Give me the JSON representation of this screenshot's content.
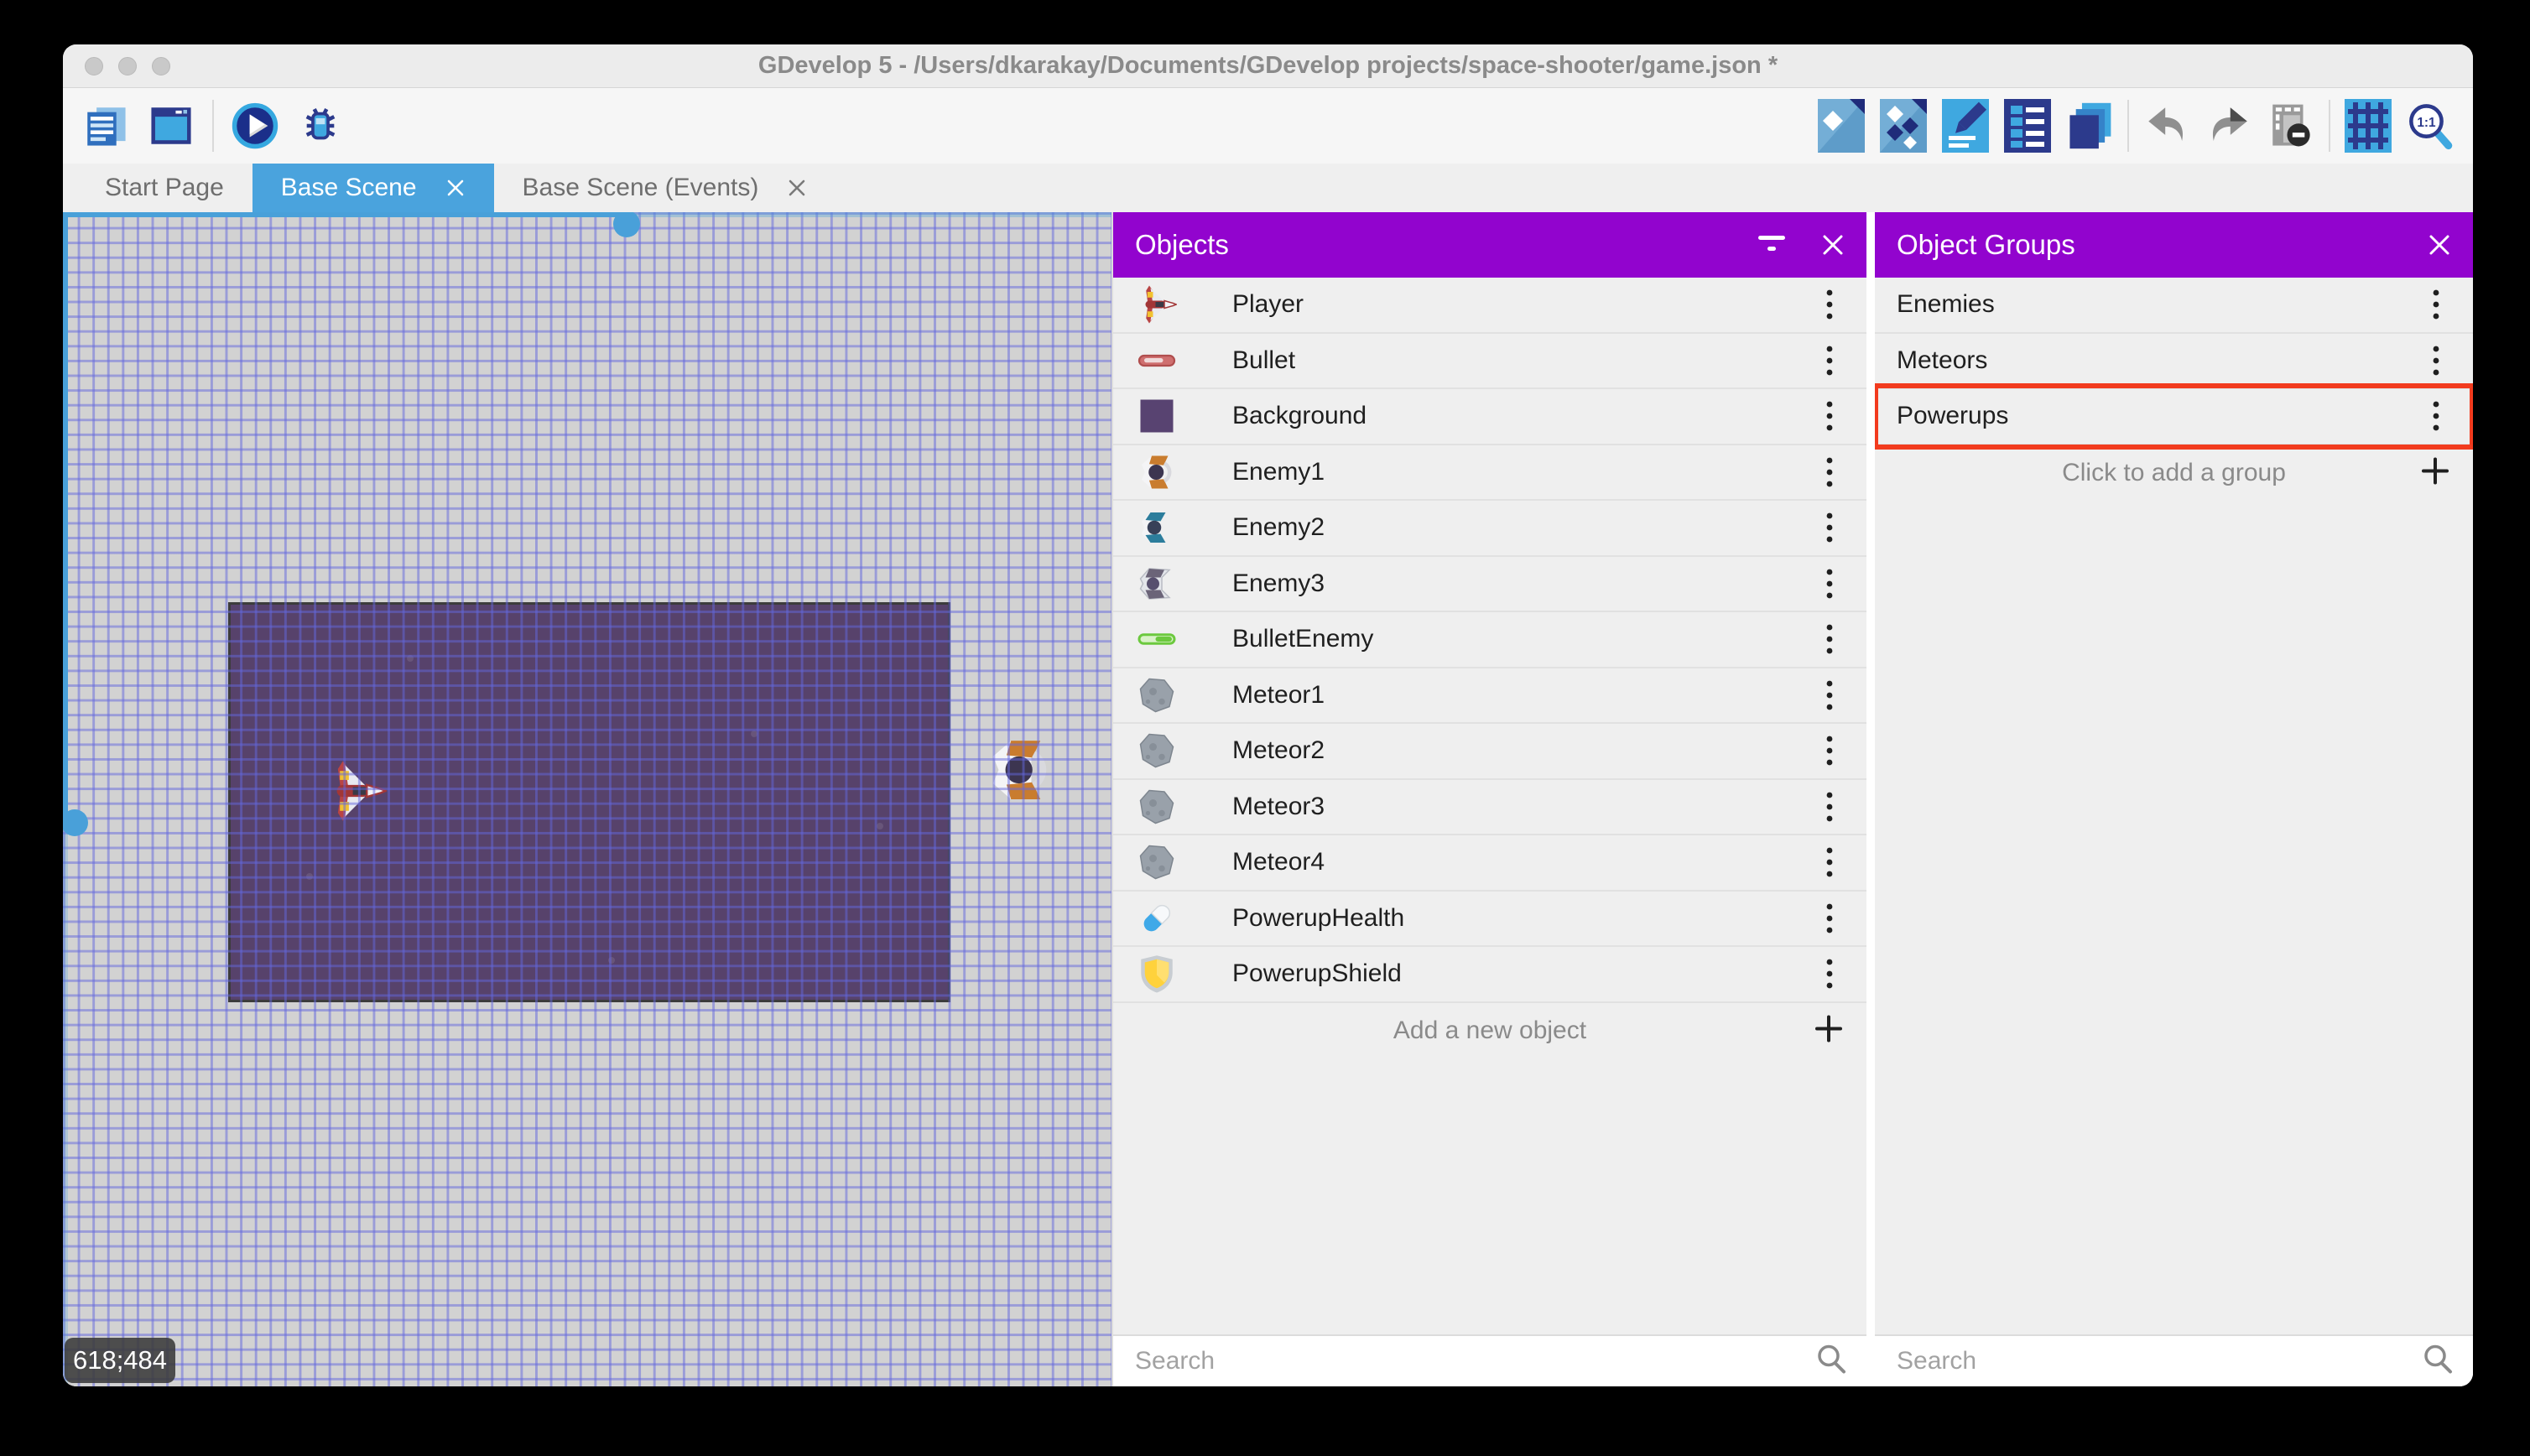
{
  "window": {
    "title": "GDevelop 5 - /Users/dkarakay/Documents/GDevelop projects/space-shooter/game.json *",
    "traffic_lights": [
      "close",
      "minimize",
      "maximize"
    ]
  },
  "toolbar": {
    "left_icons": [
      "project-manager-icon",
      "start-page-icon",
      "preview-play-icon",
      "debug-icon"
    ],
    "right_icons": [
      "objects-panel-icon",
      "object-groups-icon",
      "properties-icon",
      "instances-list-icon",
      "layers-icon",
      "undo-icon",
      "redo-icon",
      "window-mask-icon",
      "grid-icon",
      "zoom-1-1-icon"
    ]
  },
  "tabs": [
    {
      "label": "Start Page",
      "active": false,
      "closable": false
    },
    {
      "label": "Base Scene",
      "active": true,
      "closable": true
    },
    {
      "label": "Base Scene (Events)",
      "active": false,
      "closable": true
    }
  ],
  "scene": {
    "coordinates": "618;484",
    "sprites": [
      "player-ship-sprite",
      "enemy-ship-sprite"
    ]
  },
  "objects_panel": {
    "title": "Objects",
    "items": [
      {
        "name": "Player",
        "icon": "player-ship"
      },
      {
        "name": "Bullet",
        "icon": "bullet-red"
      },
      {
        "name": "Background",
        "icon": "background-square"
      },
      {
        "name": "Enemy1",
        "icon": "enemy-ship-orange"
      },
      {
        "name": "Enemy2",
        "icon": "enemy-ship-teal"
      },
      {
        "name": "Enemy3",
        "icon": "enemy-ship-gray"
      },
      {
        "name": "BulletEnemy",
        "icon": "bullet-green"
      },
      {
        "name": "Meteor1",
        "icon": "meteor"
      },
      {
        "name": "Meteor2",
        "icon": "meteor"
      },
      {
        "name": "Meteor3",
        "icon": "meteor"
      },
      {
        "name": "Meteor4",
        "icon": "meteor"
      },
      {
        "name": "PowerupHealth",
        "icon": "health-pill"
      },
      {
        "name": "PowerupShield",
        "icon": "shield"
      }
    ],
    "add_label": "Add a new object",
    "search_placeholder": "Search"
  },
  "groups_panel": {
    "title": "Object Groups",
    "items": [
      {
        "name": "Enemies"
      },
      {
        "name": "Meteors"
      },
      {
        "name": "Powerups"
      }
    ],
    "highlighted_item": "Powerups",
    "add_label": "Click to add a group",
    "search_placeholder": "Search"
  },
  "colors": {
    "panel_header_purple": "#9204ce",
    "active_tab_blue": "#4aa3dd",
    "highlight_red": "#f23b1e",
    "scene_grid_line": "#6367dd",
    "scene_background_rect": "#57426b",
    "scrollbar_blue": "#49a0d9"
  }
}
